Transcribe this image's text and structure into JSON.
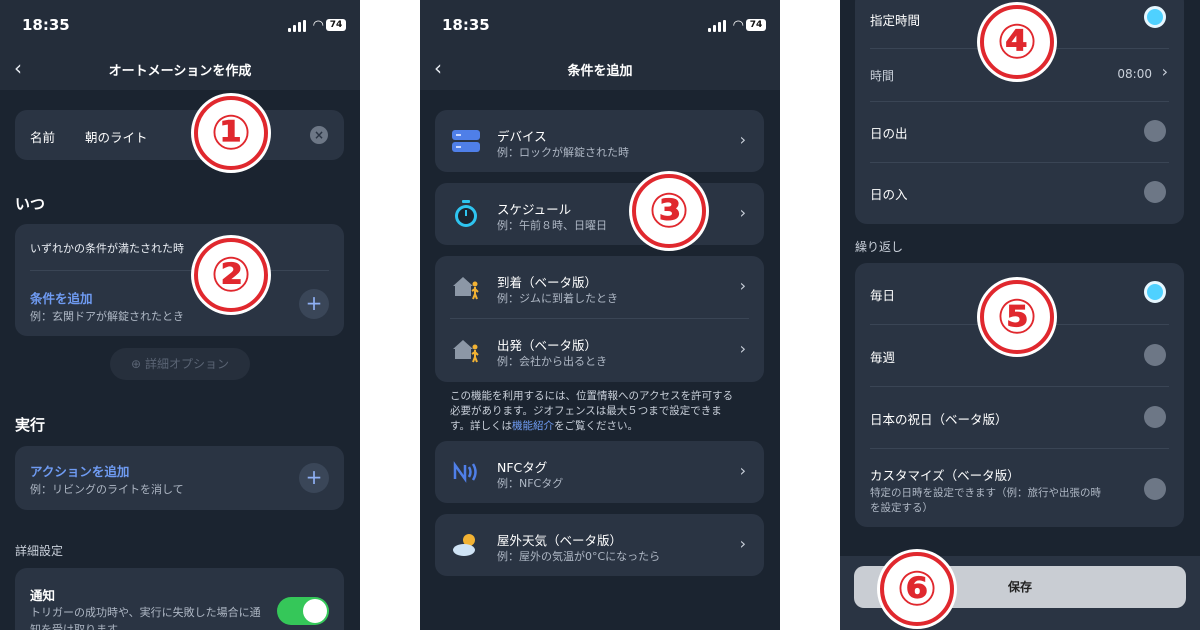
{
  "status": {
    "time": "18:35",
    "battery": "74"
  },
  "screen1": {
    "title": "オートメーションを作成",
    "name_label": "名前",
    "name_value": "朝のライト",
    "when_heading": "いつ",
    "when_condition": "いずれかの条件が満たされた時",
    "add_condition": "条件を追加",
    "add_condition_example": "例：玄関ドアが解錠されたとき",
    "detail_options": "詳細オプション",
    "exec_heading": "実行",
    "add_action": "アクションを追加",
    "add_action_example": "例：リビングのライトを消して",
    "advanced_heading": "詳細設定",
    "notify_title": "通知",
    "notify_desc1": "トリガーの成功時や、実行に失敗した場合に通",
    "notify_desc2": "知を受け取ります",
    "notify_on": true
  },
  "screen2": {
    "title": "条件を追加",
    "device": {
      "title": "デバイス",
      "example": "例：ロックが解錠された時"
    },
    "schedule": {
      "title": "スケジュール",
      "example": "例：午前８時、日曜日"
    },
    "arrive": {
      "title": "到着（ベータ版）",
      "example": "例：ジムに到着したとき"
    },
    "depart": {
      "title": "出発（ベータ版）",
      "example": "例：会社から出るとき"
    },
    "note1": "この機能を利用するには、位置情報へのアクセスを許可する",
    "note2": "必要があります。ジオフェンスは最大５つまで設定できま",
    "note3a": "す。詳しくは",
    "note3link": "機能紹介",
    "note3b": "をご覧ください。",
    "nfc": {
      "title": "NFCタグ",
      "example": "例：NFCタグ"
    },
    "weather": {
      "title": "屋外天気（ベータ版）",
      "example": "例：屋外の気温が0°Cになったら"
    }
  },
  "screen3": {
    "specified_time": "指定時間",
    "time_label": "時間",
    "time_value": "08:00",
    "sunrise": "日の出",
    "sunset": "日の入",
    "repeat_heading": "繰り返し",
    "daily": "毎日",
    "weekly": "毎週",
    "jp_holidays": "日本の祝日（ベータ版）",
    "customize": "カスタマイズ（ベータ版）",
    "customize_desc1": "特定の日時を設定できます（例：旅行や出張の時",
    "customize_desc2": "を設定する）",
    "save": "保存"
  },
  "badges": [
    "①",
    "②",
    "③",
    "④",
    "⑤",
    "⑥"
  ],
  "colors": {
    "background": "#1b2430",
    "card": "#2a3443",
    "accent": "#6f9bf2",
    "radio_on": "#4fd1ff",
    "toggle": "#35c759",
    "badge": "#e0282e"
  }
}
